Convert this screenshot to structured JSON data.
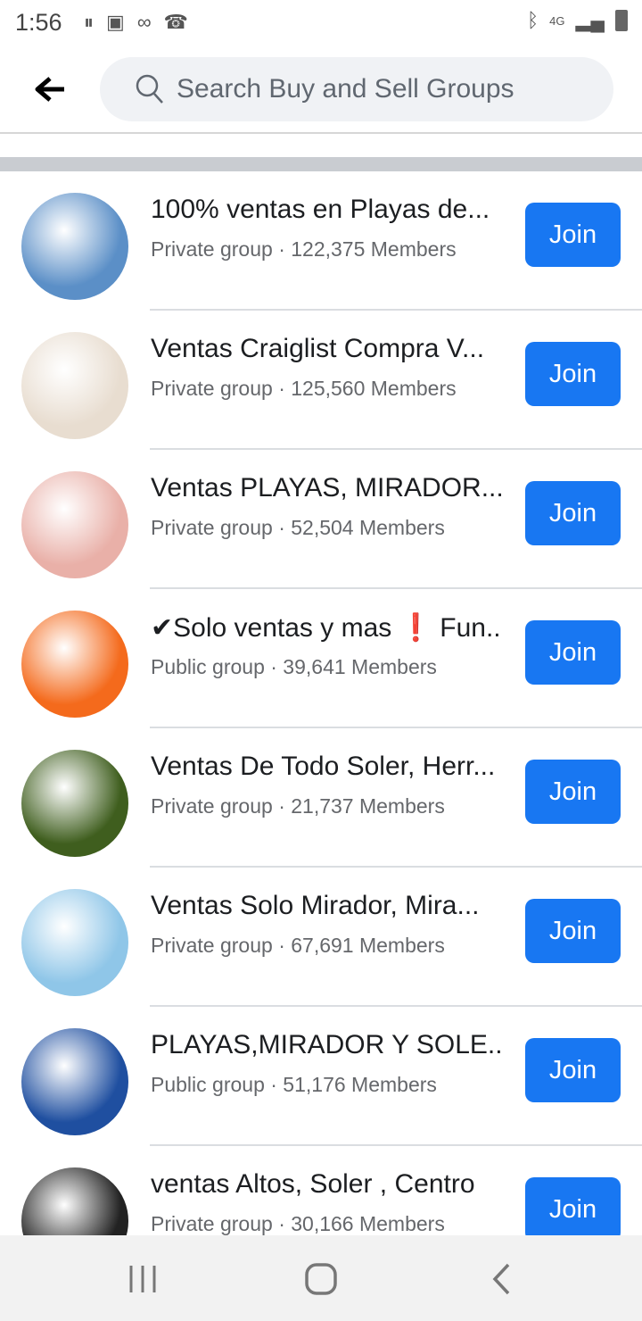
{
  "status": {
    "time": "1:56",
    "network": "4G"
  },
  "search": {
    "placeholder": "Search Buy and Sell Groups"
  },
  "groups": [
    {
      "name": "100% ventas en Playas de...",
      "meta": "Private group · 122,375 Members",
      "join": "Join",
      "color": "#5b8fc7"
    },
    {
      "name": "Ventas Craiglist Compra V...",
      "meta": "Private group · 125,560 Members",
      "join": "Join",
      "color": "#e8ddd0"
    },
    {
      "name": "Ventas PLAYAS, MIRADOR...",
      "meta": "Private group · 52,504 Members",
      "join": "Join",
      "color": "#e9b0a8"
    },
    {
      "name": "✔Solo ventas y mas ❗ Fun..",
      "meta": "Public group · 39,641 Members",
      "join": "Join",
      "color": "#f46a1c"
    },
    {
      "name": "Ventas De Todo Soler, Herr...",
      "meta": "Private group · 21,737 Members",
      "join": "Join",
      "color": "#3f5e1e"
    },
    {
      "name": "Ventas Solo Mirador, Mira...",
      "meta": "Private group · 67,691 Members",
      "join": "Join",
      "color": "#8fc6e8"
    },
    {
      "name": "PLAYAS,MIRADOR  Y SOLE..",
      "meta": "Public group · 51,176 Members",
      "join": "Join",
      "color": "#1f4fa0"
    },
    {
      "name": "ventas Altos, Soler , Centro",
      "meta": "Private group · 30,166 Members",
      "join": "Join",
      "color": "#222222"
    }
  ],
  "colors": {
    "accent": "#1877f2"
  }
}
